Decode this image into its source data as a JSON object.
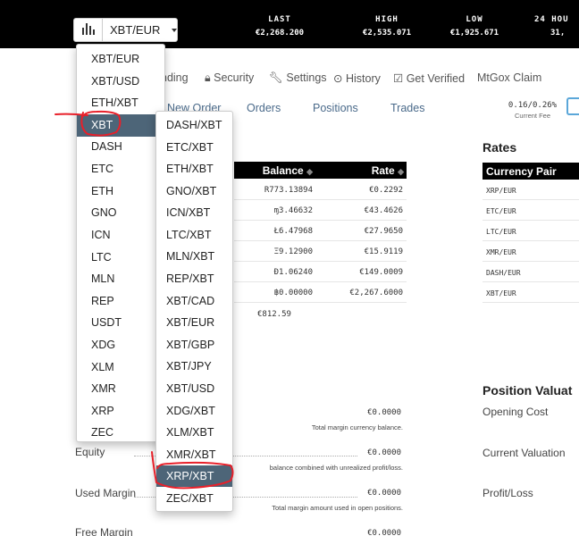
{
  "pair_button": {
    "label": "XBT/EUR"
  },
  "stats": [
    {
      "label": "LAST",
      "value": "€2,268.200"
    },
    {
      "label": "HIGH",
      "value": "€2,535.071"
    },
    {
      "label": "LOW",
      "value": "€1,925.671"
    },
    {
      "label": "24 HOU",
      "value": "31,"
    }
  ],
  "nav": [
    "nding",
    "Security",
    "Settings",
    "History",
    "Get Verified",
    "MtGox Claim"
  ],
  "tabs": [
    "New Order",
    "Orders",
    "Positions",
    "Trades"
  ],
  "fee": {
    "value": "0.16/0.26%",
    "label": "Current Fee"
  },
  "balance_table": {
    "headers": [
      "Balance",
      "Rate"
    ],
    "rows": [
      {
        "balance": "R773.13894",
        "rate": "€0.2292"
      },
      {
        "balance": "ɱ3.46632",
        "rate": "€43.4626"
      },
      {
        "balance": "Ł6.47968",
        "rate": "€27.9650"
      },
      {
        "balance": "Ξ9.12900",
        "rate": "€15.9119"
      },
      {
        "balance": "Đ1.06240",
        "rate": "€149.0009"
      },
      {
        "balance": "฿0.00000",
        "rate": "€2,267.6000"
      }
    ],
    "total": "€812.59"
  },
  "rates": {
    "title": "Rates",
    "header": "Currency Pair",
    "rows": [
      "XRP/EUR",
      "ETC/EUR",
      "LTC/EUR",
      "XMR/EUR",
      "DASH/EUR",
      "XBT/EUR"
    ]
  },
  "position": {
    "title": "Position Valuat",
    "labels": [
      "Opening Cost",
      "Current Valuation",
      "Profit/Loss"
    ]
  },
  "margin": [
    {
      "label": "",
      "value": "€0.0000",
      "desc": "Total margin currency balance."
    },
    {
      "label": "Equity",
      "value": "€0.0000",
      "desc": "balance combined with unrealized profit/loss."
    },
    {
      "label": "Used Margin",
      "value": "€0.0000",
      "desc": "Total margin amount used in open positions."
    },
    {
      "label": "Free Margin",
      "value": "€0.0000",
      "desc": ""
    }
  ],
  "menu_primary": [
    "XBT/EUR",
    "XBT/USD",
    "ETH/XBT",
    "XBT",
    "DASH",
    "ETC",
    "ETH",
    "GNO",
    "ICN",
    "LTC",
    "MLN",
    "REP",
    "USDT",
    "XDG",
    "XLM",
    "XMR",
    "XRP",
    "ZEC"
  ],
  "menu_primary_active": "XBT",
  "menu_xbt": [
    "DASH/XBT",
    "ETC/XBT",
    "ETH/XBT",
    "GNO/XBT",
    "ICN/XBT",
    "LTC/XBT",
    "MLN/XBT",
    "REP/XBT",
    "XBT/CAD",
    "XBT/EUR",
    "XBT/GBP",
    "XBT/JPY",
    "XBT/USD",
    "XDG/XBT",
    "XLM/XBT",
    "XMR/XBT",
    "XRP/XBT",
    "ZEC/XBT"
  ],
  "menu_xbt_active": "XRP/XBT",
  "colors": {
    "topbar": "#000000",
    "menu_active": "#4d6578",
    "annotation": "#e8202a",
    "accent": "#5ba7d9"
  }
}
